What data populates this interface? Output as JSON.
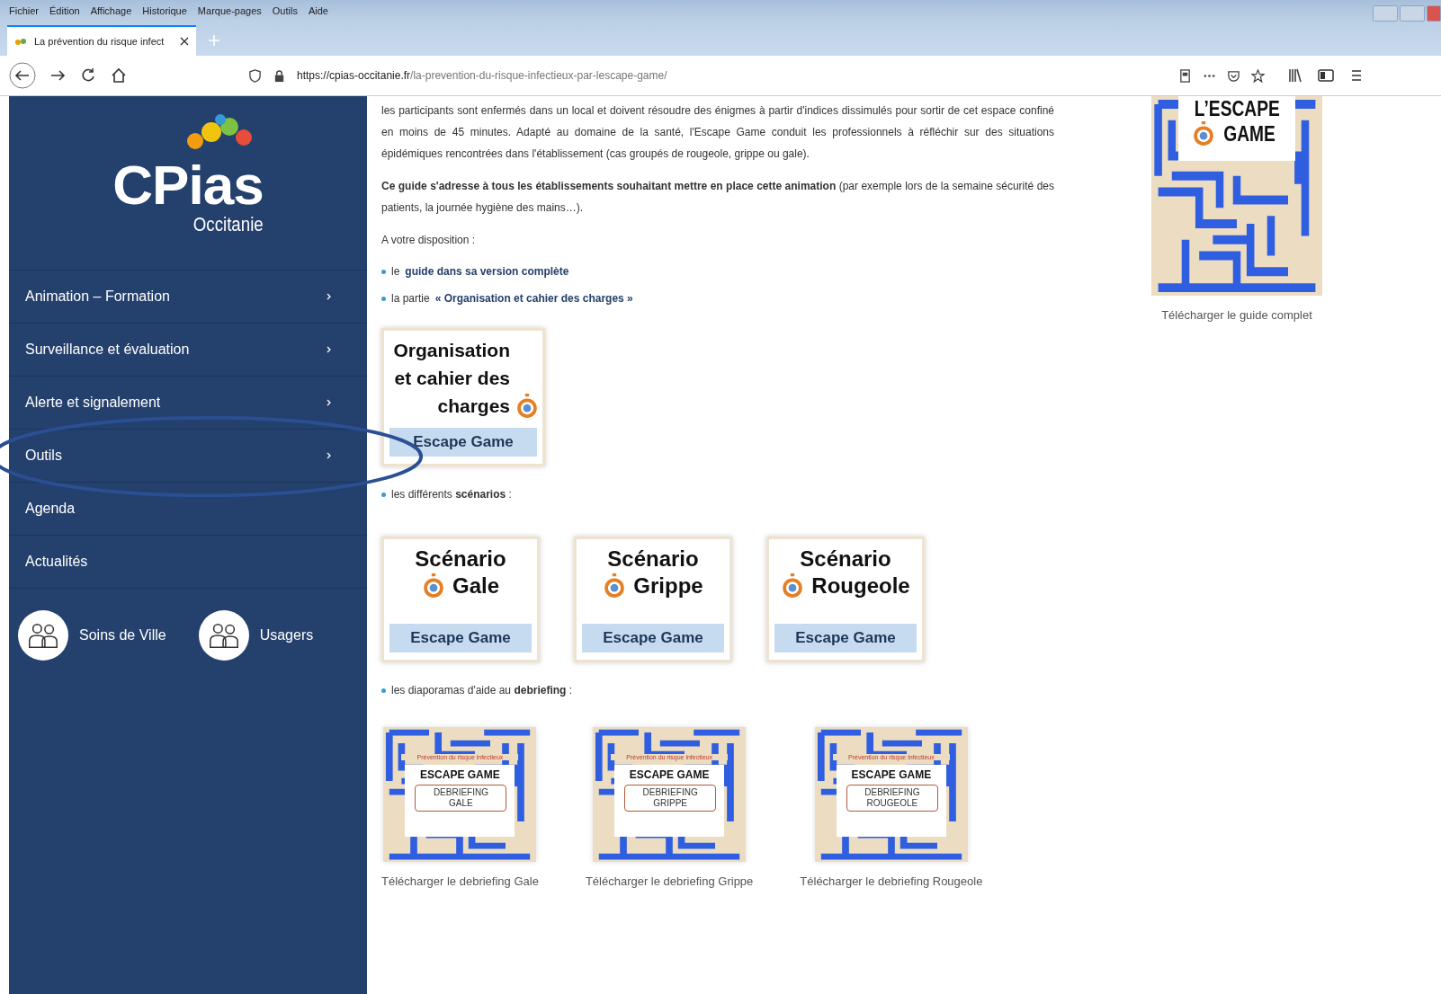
{
  "browser": {
    "menu": [
      "Fichier",
      "Édition",
      "Affichage",
      "Historique",
      "Marque-pages",
      "Outils",
      "Aide"
    ],
    "tab": {
      "title": "La prévention du risque infect",
      "selected": true
    },
    "url": {
      "domain": "https://cpias-occitanie.fr",
      "path": "/la-prevention-du-risque-infectieux-par-lescape-game/"
    }
  },
  "sidebar": {
    "logo": {
      "name": "CPias",
      "region": "Occitanie"
    },
    "items": [
      {
        "label": "Animation – Formation",
        "has_submenu": true,
        "circled": false
      },
      {
        "label": "Surveillance et évaluation",
        "has_submenu": true,
        "circled": false
      },
      {
        "label": "Alerte et signalement",
        "has_submenu": true,
        "circled": false
      },
      {
        "label": "Outils",
        "has_submenu": true,
        "circled": true
      },
      {
        "label": "Agenda",
        "has_submenu": false,
        "circled": false
      },
      {
        "label": "Actualités",
        "has_submenu": false,
        "circled": false
      }
    ],
    "audiences": [
      {
        "label": "Soins de Ville"
      },
      {
        "label": "Usagers"
      }
    ]
  },
  "content": {
    "blocks": [
      {
        "kind": "paragraph",
        "text": "les participants sont enfermés dans un local et doivent résoudre des énigmes à partir d'indices dissimulés pour sortir de cet espace confiné en moins de 45 minutes. Adapté au domaine de la santé, l'Escape Game conduit les professionnels à réfléchir sur des situations épidémiques rencontrées dans l'établissement (cas groupés de rougeole, grippe ou gale)."
      },
      {
        "kind": "paragraph",
        "text": "**Ce guide s'adresse à tous les établissements souhaitant mettre en place cette animation** (par exemple lors de la semaine sécurité des patients, la journée hygiène des mains…)."
      },
      {
        "kind": "paragraph",
        "text": "A votre disposition :"
      },
      {
        "kind": "link_bullet",
        "prefix": "le",
        "link": "guide dans sa version complète"
      },
      {
        "kind": "link_bullet",
        "prefix": "la partie",
        "link": "« Organisation et cahier des charges »"
      },
      {
        "kind": "cards",
        "cards": [
          {
            "title": "Organisation et cahier des charges",
            "band": "Escape Game"
          }
        ]
      },
      {
        "kind": "bullet",
        "text": "les différents **scénarios** :"
      },
      {
        "kind": "cards",
        "cards": [
          {
            "title": "Scénario",
            "subtitle": "Gale",
            "band": "Escape Game"
          },
          {
            "title": "Scénario",
            "subtitle": "Grippe",
            "band": "Escape Game"
          },
          {
            "title": "Scénario",
            "subtitle": "Rougeole",
            "band": "Escape Game"
          }
        ]
      },
      {
        "kind": "bullet",
        "text": "les diaporamas d'aide au **debriefing** :"
      },
      {
        "kind": "thumbnails",
        "items": [
          {
            "header": "Prévention du risque infectieux",
            "title": "ESCAPE GAME",
            "badge": [
              "DEBRIEFING",
              "GALE"
            ],
            "caption": "Télécharger le debriefing Gale"
          },
          {
            "header": "Prévention du risque infectieux",
            "title": "ESCAPE GAME",
            "badge": [
              "DEBRIEFING",
              "GRIPPE"
            ],
            "caption": "Télécharger le debriefing Grippe"
          },
          {
            "header": "Prévention du risque infectieux",
            "title": "ESCAPE GAME",
            "badge": [
              "DEBRIEFING",
              "ROUGEOLE"
            ],
            "caption": "Télécharger le debriefing Rougeole"
          }
        ]
      }
    ],
    "cover": {
      "title": [
        "L’ESCAPE",
        "GAME"
      ],
      "caption": "Télécharger le guide complet"
    }
  }
}
